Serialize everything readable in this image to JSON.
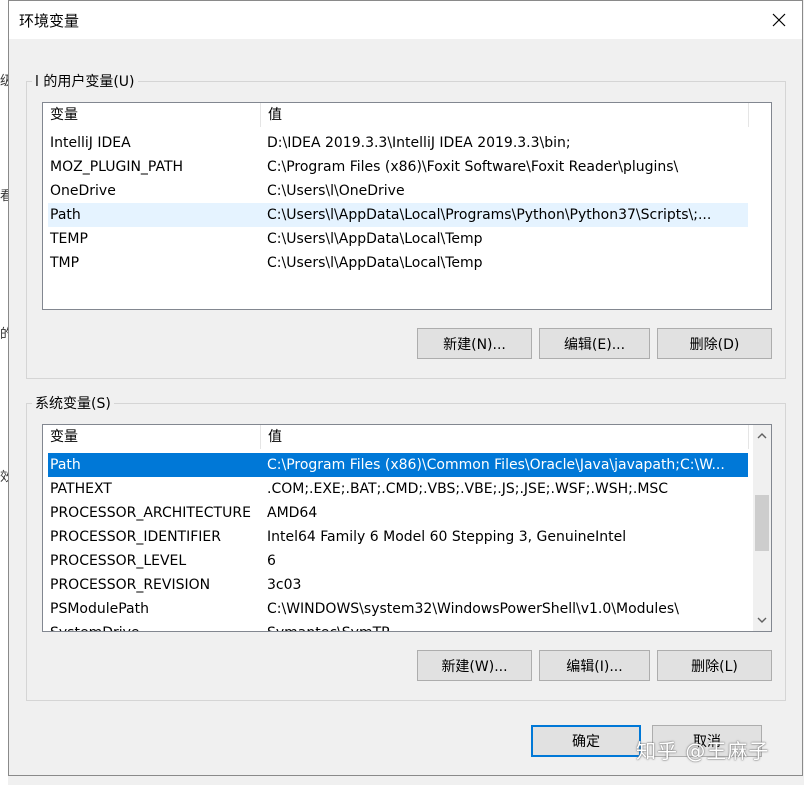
{
  "window": {
    "title": "环境变量"
  },
  "background_fragments": [
    "级",
    "看",
    "的:",
    "效"
  ],
  "user_vars": {
    "group_label": "l 的用户变量(U)",
    "headers": [
      "变量",
      "值"
    ],
    "rows": [
      {
        "name": "IntelliJ IDEA",
        "value": "D:\\IDEA 2019.3.3\\IntelliJ IDEA 2019.3.3\\bin;"
      },
      {
        "name": "MOZ_PLUGIN_PATH",
        "value": "C:\\Program Files (x86)\\Foxit Software\\Foxit Reader\\plugins\\"
      },
      {
        "name": "OneDrive",
        "value": "C:\\Users\\l\\OneDrive"
      },
      {
        "name": "Path",
        "value": "C:\\Users\\l\\AppData\\Local\\Programs\\Python\\Python37\\Scripts\\;..."
      },
      {
        "name": "TEMP",
        "value": "C:\\Users\\l\\AppData\\Local\\Temp"
      },
      {
        "name": "TMP",
        "value": "C:\\Users\\l\\AppData\\Local\\Temp"
      }
    ],
    "buttons": {
      "new": "新建(N)...",
      "edit": "编辑(E)...",
      "delete": "删除(D)"
    }
  },
  "system_vars": {
    "group_label": "系统变量(S)",
    "headers": [
      "变量",
      "值"
    ],
    "rows": [
      {
        "name": "Path",
        "value": "C:\\Program Files (x86)\\Common Files\\Oracle\\Java\\javapath;C:\\W..."
      },
      {
        "name": "PATHEXT",
        "value": ".COM;.EXE;.BAT;.CMD;.VBS;.VBE;.JS;.JSE;.WSF;.WSH;.MSC"
      },
      {
        "name": "PROCESSOR_ARCHITECTURE",
        "value": "AMD64"
      },
      {
        "name": "PROCESSOR_IDENTIFIER",
        "value": "Intel64 Family 6 Model 60 Stepping 3, GenuineIntel"
      },
      {
        "name": "PROCESSOR_LEVEL",
        "value": "6"
      },
      {
        "name": "PROCESSOR_REVISION",
        "value": "3c03"
      },
      {
        "name": "PSModulePath",
        "value": "C:\\WINDOWS\\system32\\WindowsPowerShell\\v1.0\\Modules\\"
      },
      {
        "name": "SystemDrive",
        "value": "Symantec\\SymTP"
      }
    ],
    "buttons": {
      "new": "新建(W)...",
      "edit": "编辑(I)...",
      "delete": "删除(L)"
    }
  },
  "footer": {
    "ok": "确定",
    "cancel": "取消"
  },
  "watermark": "知乎 @王麻子",
  "colors": {
    "selection": "#0078d7",
    "hover": "#e5f3ff",
    "default_button_border": "#0078d7"
  },
  "icons": {
    "close": "close-icon",
    "scroll_up": "chevron-up-icon",
    "scroll_down": "chevron-down-icon"
  }
}
